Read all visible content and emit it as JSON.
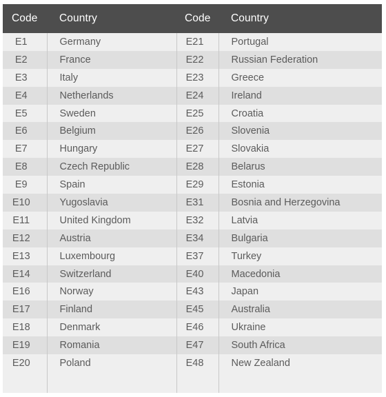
{
  "table": {
    "headers": {
      "code_left": "Code",
      "country_left": "Country",
      "code_right": "Code",
      "country_right": "Country"
    },
    "colors": {
      "header_bg": "#4d4d4d",
      "header_text": "#ffffff",
      "row_light": "#efefef",
      "row_dark": "#dfdfdf",
      "cell_text": "#5b5b5b",
      "divider": "#c8c8c8",
      "page_bg": "#ffffff"
    },
    "rows": [
      {
        "code_left": "E1",
        "country_left": "Germany",
        "code_right": "E21",
        "country_right": "Portugal"
      },
      {
        "code_left": "E2",
        "country_left": "France",
        "code_right": "E22",
        "country_right": "Russian Federation"
      },
      {
        "code_left": "E3",
        "country_left": "Italy",
        "code_right": "E23",
        "country_right": "Greece"
      },
      {
        "code_left": "E4",
        "country_left": "Netherlands",
        "code_right": "E24",
        "country_right": "Ireland"
      },
      {
        "code_left": "E5",
        "country_left": "Sweden",
        "code_right": "E25",
        "country_right": "Croatia"
      },
      {
        "code_left": "E6",
        "country_left": "Belgium",
        "code_right": "E26",
        "country_right": "Slovenia"
      },
      {
        "code_left": "E7",
        "country_left": "Hungary",
        "code_right": "E27",
        "country_right": "Slovakia"
      },
      {
        "code_left": "E8",
        "country_left": "Czech Republic",
        "code_right": "E28",
        "country_right": "Belarus"
      },
      {
        "code_left": "E9",
        "country_left": "Spain",
        "code_right": "E29",
        "country_right": "Estonia"
      },
      {
        "code_left": "E10",
        "country_left": "Yugoslavia",
        "code_right": "E31",
        "country_right": "Bosnia and Herzegovina"
      },
      {
        "code_left": "E11",
        "country_left": "United Kingdom",
        "code_right": "E32",
        "country_right": "Latvia"
      },
      {
        "code_left": "E12",
        "country_left": "Austria",
        "code_right": "E34",
        "country_right": "Bulgaria"
      },
      {
        "code_left": "E13",
        "country_left": "Luxembourg",
        "code_right": "E37",
        "country_right": "Turkey"
      },
      {
        "code_left": "E14",
        "country_left": "Switzerland",
        "code_right": "E40",
        "country_right": "Macedonia"
      },
      {
        "code_left": "E16",
        "country_left": "Norway",
        "code_right": "E43",
        "country_right": "Japan"
      },
      {
        "code_left": "E17",
        "country_left": "Finland",
        "code_right": "E45",
        "country_right": "Australia"
      },
      {
        "code_left": "E18",
        "country_left": "Denmark",
        "code_right": "E46",
        "country_right": "Ukraine"
      },
      {
        "code_left": "E19",
        "country_left": "Romania",
        "code_right": "E47",
        "country_right": "South Africa"
      },
      {
        "code_left": "E20",
        "country_left": "Poland",
        "code_right": "E48",
        "country_right": "New Zealand"
      }
    ]
  }
}
